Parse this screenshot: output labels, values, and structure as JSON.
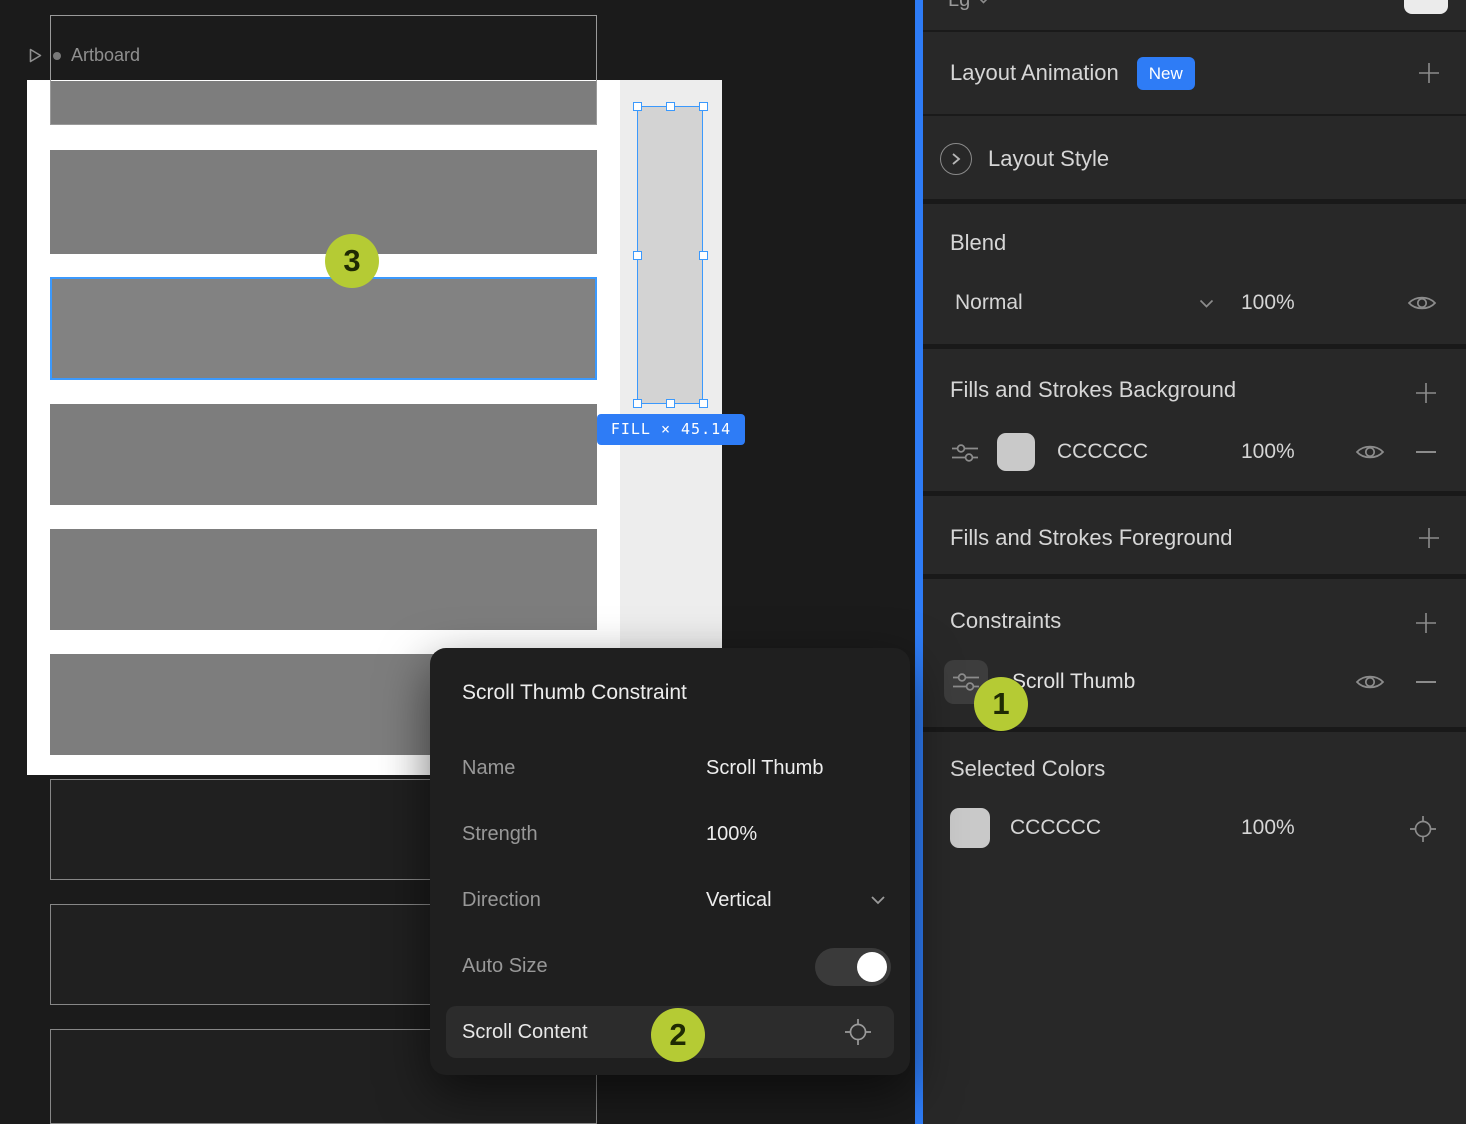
{
  "colors": {
    "accent_blue": "#2E7CF6",
    "selection_blue": "#3B99FD",
    "badge_green": "#B5CB34",
    "swatch_gray": "#C9C9C9"
  },
  "canvas": {
    "artboard_label": "Artboard",
    "fill_badge": "FILL × 45.14",
    "annotation_1": "1",
    "annotation_2": "2",
    "annotation_3": "3"
  },
  "popup": {
    "title": "Scroll Thumb Constraint",
    "name_label": "Name",
    "name_value": "Scroll Thumb",
    "strength_label": "Strength",
    "strength_value": "100%",
    "direction_label": "Direction",
    "direction_value": "Vertical",
    "auto_size_label": "Auto Size",
    "scroll_content_label": "Scroll Content"
  },
  "panel": {
    "top_partial": "Lg",
    "layout_animation_title": "Layout Animation",
    "layout_animation_badge": "New",
    "layout_style_title": "Layout Style",
    "blend_title": "Blend",
    "blend_mode": "Normal",
    "blend_opacity": "100%",
    "fills_bg_title": "Fills and Strokes Background",
    "fills_bg_color": "CCCCCC",
    "fills_bg_opacity": "100%",
    "fills_fg_title": "Fills and Strokes Foreground",
    "constraints_title": "Constraints",
    "constraints_item": "Scroll Thumb",
    "selected_colors_title": "Selected Colors",
    "selected_color_hex": "CCCCCC",
    "selected_color_opacity": "100%"
  }
}
